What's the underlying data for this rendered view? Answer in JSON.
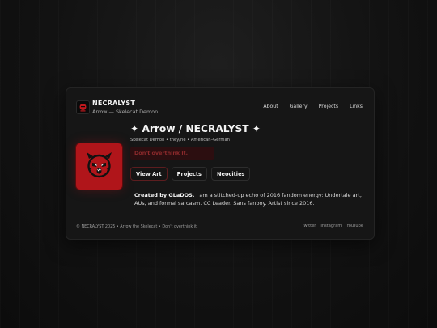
{
  "brand": {
    "title": "NECRALYST",
    "subtitle": "Arrow — Skelecat Demon",
    "logo_icon": "skelecat-logo-icon"
  },
  "nav": [
    "About",
    "Gallery",
    "Projects",
    "Links"
  ],
  "profile": {
    "title": "✦ Arrow / NECRALYST ✦",
    "meta": "Skelecat Demon • they/he • American–German",
    "warning": "Don't overthink it.",
    "avatar_icon": "skelecat-demon-avatar"
  },
  "buttons": [
    "View Art",
    "Projects",
    "Neocities"
  ],
  "about": {
    "lead": "Created by GLaDOS.",
    "text": " I am a stitched-up echo of 2016 fandom energy: Undertale art, AUs, and formal sarcasm. CC Leader. Sans fanboy. Artist since 2016."
  },
  "footer": {
    "text": "© NECRALYST 2025 • Arrow the Skelecat • Don't overthink it.",
    "links": [
      "Twitter",
      "Instagram",
      "YouTube"
    ]
  },
  "colors": {
    "accent": "#b0151a",
    "background": "#121212",
    "card": "#161616"
  }
}
